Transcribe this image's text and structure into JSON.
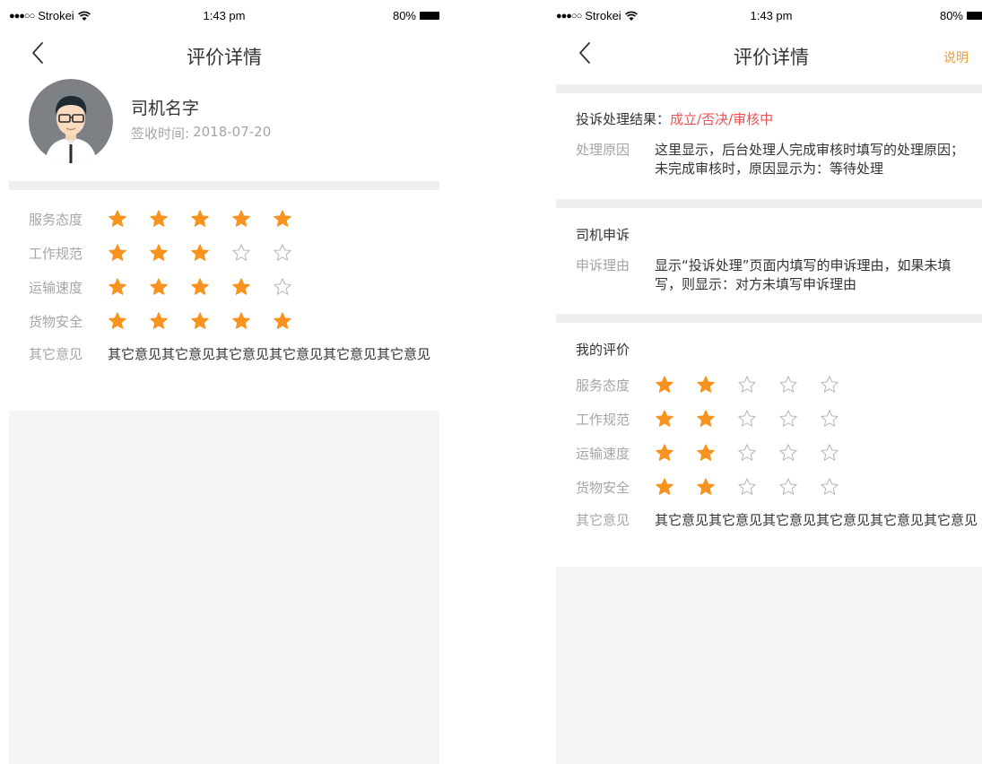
{
  "status_bar": {
    "signal_dots": "●●●○○",
    "carrier": "Strokei",
    "time": "1:43 pm",
    "battery": "80%"
  },
  "left": {
    "nav": {
      "title": "评价详情"
    },
    "profile": {
      "name": "司机名字",
      "sign_label": "签收时间:",
      "sign_date": "2018-07-20"
    },
    "ratings": [
      {
        "label": "服务态度",
        "stars": 5
      },
      {
        "label": "工作规范",
        "stars": 3
      },
      {
        "label": "运输速度",
        "stars": 4
      },
      {
        "label": "货物安全",
        "stars": 5
      }
    ],
    "comment": {
      "label": "其它意见",
      "text": "其它意见其它意见其它意见其它意见其它意见其它意见"
    }
  },
  "right": {
    "nav": {
      "title": "评价详情",
      "action": "说明"
    },
    "complaint": {
      "title": "投诉处理结果：",
      "result": "成立/否决/审核中",
      "reason_label": "处理原因",
      "reason_text": "这里显示，后台处理人完成审核时填写的处理原因；未完成审核时，原因显示为：等待处理"
    },
    "appeal": {
      "title": "司机申诉",
      "reason_label": "申诉理由",
      "reason_text": "显示“投诉处理”页面内填写的申诉理由，如果未填写，则显示：对方未填写申诉理由"
    },
    "my_rating": {
      "title": "我的评价",
      "ratings": [
        {
          "label": "服务态度",
          "stars": 2
        },
        {
          "label": "工作规范",
          "stars": 2
        },
        {
          "label": "运输速度",
          "stars": 2
        },
        {
          "label": "货物安全",
          "stars": 2
        }
      ],
      "comment": {
        "label": "其它意见",
        "text": "其它意见其它意见其它意见其它意见其它意见其它意见"
      }
    }
  },
  "colors": {
    "star_filled": "#f7931e",
    "star_empty": "#b5b5b5",
    "accent": "#f39a2b",
    "result": "#f25052",
    "divider": "#efefef"
  },
  "icons": {
    "back": "back-chevron-icon",
    "wifi": "wifi-icon",
    "battery": "battery-icon",
    "star": "star-icon",
    "avatar": "avatar-icon"
  }
}
